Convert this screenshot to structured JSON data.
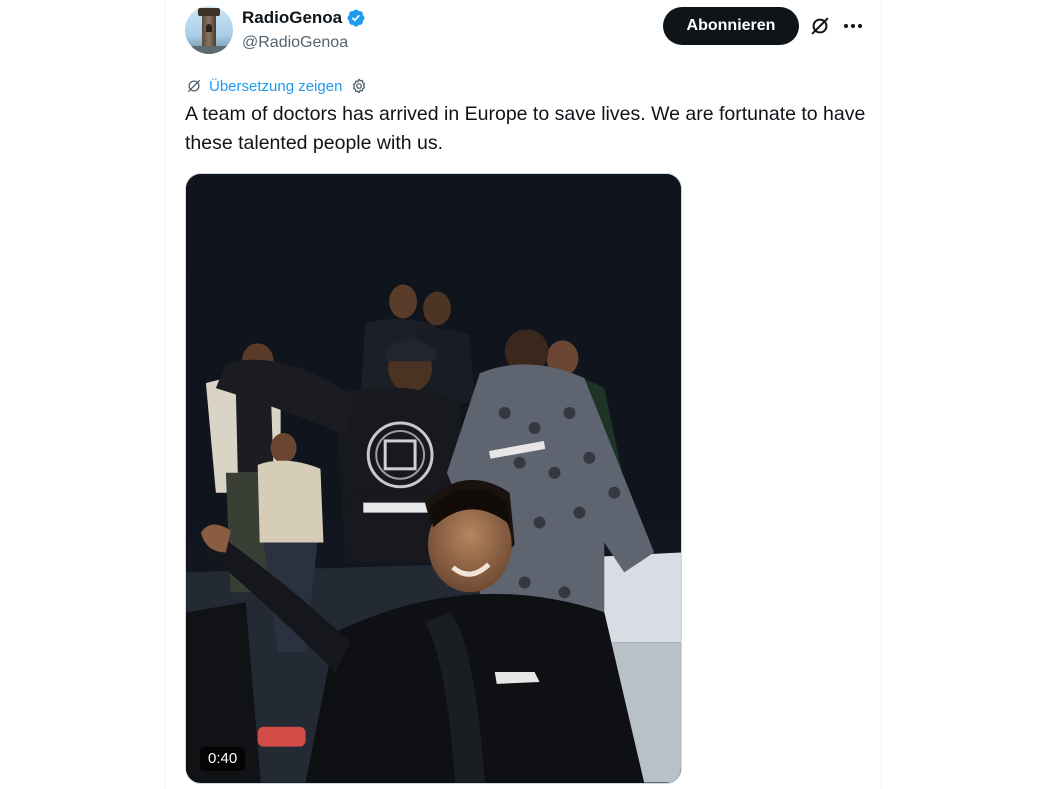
{
  "tweet": {
    "author": {
      "display_name": "RadioGenoa",
      "handle": "@RadioGenoa",
      "verified": true,
      "verified_color": "#1d9bf0"
    },
    "subscribe_label": "Abonnieren",
    "translate_label": "Übersetzung zeigen",
    "text": "A team of doctors has arrived in Europe to save lives. We are fortunate to have these talented people with us.",
    "media": {
      "type": "video",
      "duration": "0:40"
    }
  },
  "icons": {
    "verified": "verified-badge-icon",
    "grok": "grok-icon",
    "more": "more-icon",
    "translate": "translate-icon",
    "settings": "gear-icon"
  },
  "colors": {
    "accent": "#1d9bf0",
    "button": "#0f1419",
    "secondary_text": "#536471"
  }
}
